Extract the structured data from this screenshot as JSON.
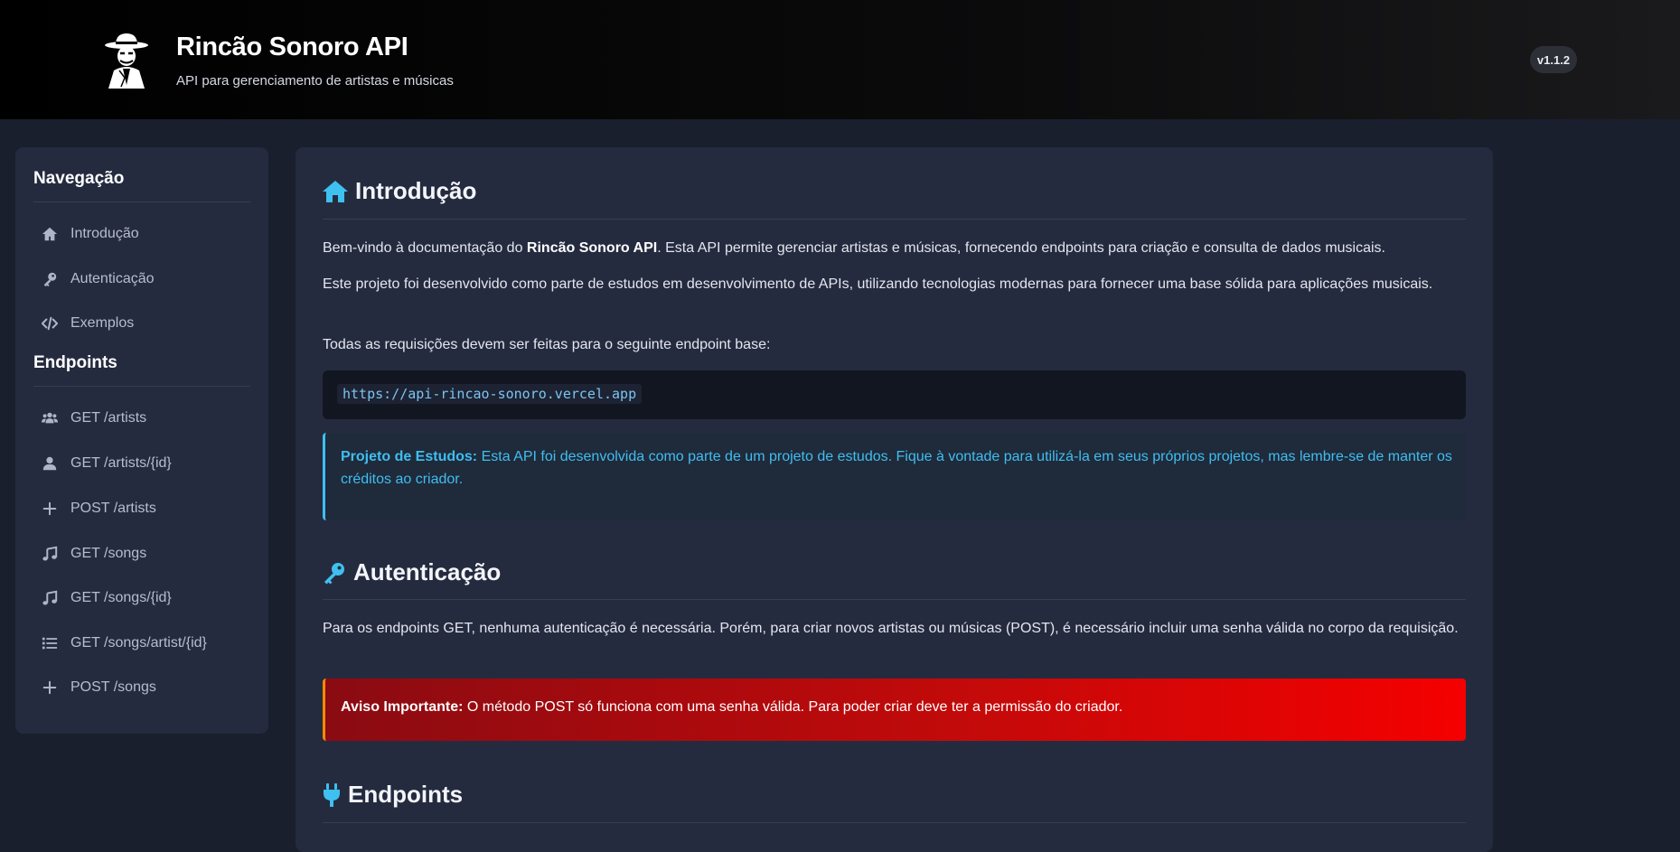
{
  "header": {
    "title": "Rincão Sonoro API",
    "subtitle": "API para gerenciamento de artistas e músicas",
    "version": "v1.1.2"
  },
  "sidebar": {
    "nav_heading": "Navegação",
    "nav_items": [
      {
        "label": "Introdução",
        "icon": "home-icon"
      },
      {
        "label": "Autenticação",
        "icon": "key-icon"
      },
      {
        "label": "Exemplos",
        "icon": "code-icon"
      }
    ],
    "endpoints_heading": "Endpoints",
    "endpoint_items": [
      {
        "label": "GET /artists",
        "icon": "users-icon"
      },
      {
        "label": "GET /artists/{id}",
        "icon": "user-icon"
      },
      {
        "label": "POST /artists",
        "icon": "plus-icon"
      },
      {
        "label": "GET /songs",
        "icon": "music-icon"
      },
      {
        "label": "GET /songs/{id}",
        "icon": "music-icon"
      },
      {
        "label": "GET /songs/artist/{id}",
        "icon": "list-icon"
      },
      {
        "label": "POST /songs",
        "icon": "plus-icon"
      }
    ]
  },
  "intro": {
    "title": "Introdução",
    "p1_prefix": "Bem-vindo à documentação do ",
    "p1_bold": "Rincão Sonoro API",
    "p1_suffix": ". Esta API permite gerenciar artistas e músicas, fornecendo endpoints para criação e consulta de dados musicais.",
    "p2": "Este projeto foi desenvolvido como parte de estudos em desenvolvimento de APIs, utilizando tecnologias modernas para fornecer uma base sólida para aplicações musicais.",
    "p3": "Todas as requisições devem ser feitas para o seguinte endpoint base:",
    "base_url": "https://api-rincao-sonoro.vercel.app",
    "info_label": "Projeto de Estudos:",
    "info_text": " Esta API foi desenvolvida como parte de um projeto de estudos. Fique à vontade para utilizá-la em seus próprios projetos, mas lembre-se de manter os créditos ao criador."
  },
  "auth": {
    "title": "Autenticação",
    "p1": "Para os endpoints GET, nenhuma autenticação é necessária. Porém, para criar novos artistas ou músicas (POST), é necessário incluir uma senha válida no corpo da requisição.",
    "warning_label": "Aviso Importante:",
    "warning_text": " O método POST só funciona com uma senha válida. Para poder criar deve ter a permissão do criador."
  },
  "endpoints": {
    "title": "Endpoints"
  },
  "colors": {
    "accent": "#3ec0f0",
    "warning_left": "#8a0b12",
    "warning_right": "#f50000",
    "warning_border": "#ff8a00"
  }
}
